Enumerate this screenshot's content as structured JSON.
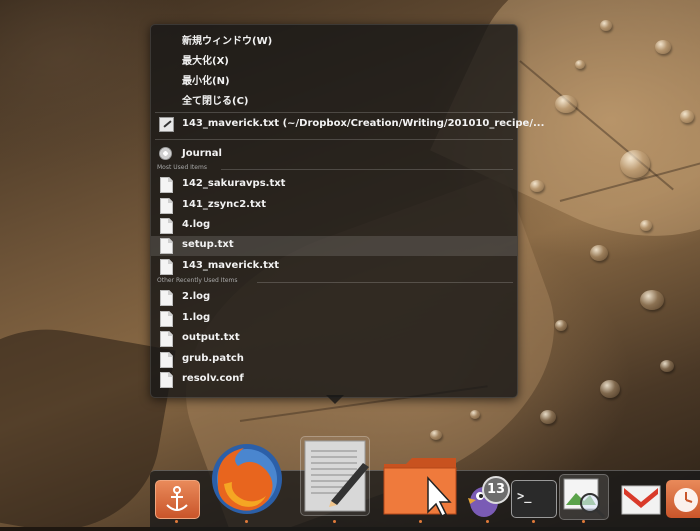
{
  "window_actions": [
    {
      "label": "新規ウィンドウ(W)"
    },
    {
      "label": "最大化(X)"
    },
    {
      "label": "最小化(N)"
    },
    {
      "label": "全て閉じる(C)"
    }
  ],
  "current_document": {
    "label": "143_maverick.txt (~/Dropbox/Creation/Writing/201010_recipe/..."
  },
  "journal": {
    "label": "Journal"
  },
  "most_used": {
    "header": "Most Used Items",
    "items": [
      "142_sakuravps.txt",
      "141_zsync2.txt",
      "4.log",
      "setup.txt",
      "143_maverick.txt"
    ]
  },
  "other_recent": {
    "header": "Other Recently Used Items",
    "items": [
      "2.log",
      "1.log",
      "output.txt",
      "grub.patch",
      "resolv.conf"
    ]
  },
  "highlighted_item": "setup.txt",
  "dock": {
    "apps": [
      {
        "name": "anchor-app",
        "icon": "anchor-icon",
        "running": true
      },
      {
        "name": "firefox",
        "icon": "firefox-icon",
        "running": true
      },
      {
        "name": "text-editor",
        "icon": "text-editor-icon",
        "running": true
      },
      {
        "name": "file-manager",
        "icon": "folder-icon",
        "running": true
      },
      {
        "name": "pidgin",
        "icon": "pidgin-icon",
        "badge": "13",
        "running": true
      },
      {
        "name": "terminal",
        "icon": "terminal-icon",
        "running": true
      },
      {
        "name": "image-viewer",
        "icon": "image-viewer-icon",
        "running": true
      },
      {
        "name": "gmail",
        "icon": "gmail-icon",
        "running": false
      },
      {
        "name": "backup",
        "icon": "backup-icon",
        "running": false
      }
    ]
  },
  "colors": {
    "accent": "#e07a3a",
    "menu_bg": "#161616",
    "highlight": "#4a4a4a"
  }
}
